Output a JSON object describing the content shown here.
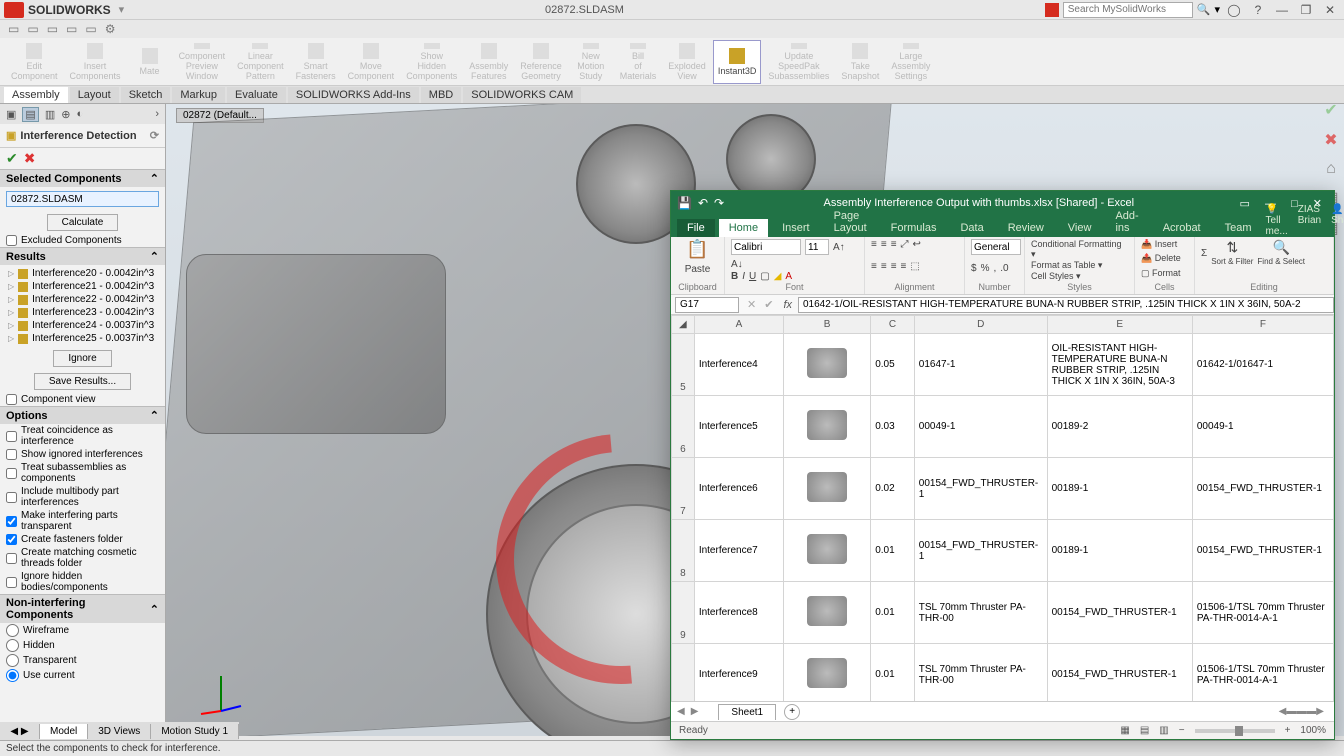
{
  "sw": {
    "brand": "SOLIDWORKS",
    "doc_title": "02872.SLDASM",
    "search_placeholder": "Search MySolidWorks",
    "ribbon": [
      {
        "label": "Edit Component"
      },
      {
        "label": "Insert Components"
      },
      {
        "label": "Mate"
      },
      {
        "label": "Component Preview Window"
      },
      {
        "label": "Linear Component Pattern"
      },
      {
        "label": "Smart Fasteners"
      },
      {
        "label": "Move Component"
      },
      {
        "label": "Show Hidden Components"
      },
      {
        "label": "Assembly Features"
      },
      {
        "label": "Reference Geometry"
      },
      {
        "label": "New Motion Study"
      },
      {
        "label": "Bill of Materials"
      },
      {
        "label": "Exploded View"
      },
      {
        "label": "Instant3D",
        "active": true
      },
      {
        "label": "Update SpeedPak Subassemblies"
      },
      {
        "label": "Take Snapshot"
      },
      {
        "label": "Large Assembly Settings"
      }
    ],
    "tabs": [
      "Assembly",
      "Layout",
      "Sketch",
      "Markup",
      "Evaluate",
      "SOLIDWORKS Add-Ins",
      "MBD",
      "SOLIDWORKS CAM"
    ],
    "active_tab": "Assembly",
    "viewport_tag": "02872  (Default...",
    "panel": {
      "title": "Interference Detection",
      "selected_head": "Selected Components",
      "selected_value": "02872.SLDASM",
      "calculate": "Calculate",
      "excluded_head": "Excluded Components",
      "results_head": "Results",
      "results": [
        "Interference20 - 0.0042in^3",
        "Interference21 - 0.0042in^3",
        "Interference22 - 0.0042in^3",
        "Interference23 - 0.0042in^3",
        "Interference24 - 0.0037in^3",
        "Interference25 - 0.0037in^3"
      ],
      "ignore": "Ignore",
      "save_results": "Save Results...",
      "component_view": "Component view",
      "options_head": "Options",
      "options": [
        {
          "label": "Treat coincidence as interference",
          "checked": false
        },
        {
          "label": "Show ignored interferences",
          "checked": false
        },
        {
          "label": "Treat subassemblies as components",
          "checked": false
        },
        {
          "label": "Include multibody part interferences",
          "checked": false
        },
        {
          "label": "Make interfering parts transparent",
          "checked": true
        },
        {
          "label": "Create fasteners folder",
          "checked": true
        },
        {
          "label": "Create matching cosmetic threads folder",
          "checked": false
        },
        {
          "label": "Ignore hidden bodies/components",
          "checked": false
        }
      ],
      "nonint_head": "Non-interfering Components",
      "nonint": [
        {
          "label": "Wireframe",
          "selected": false
        },
        {
          "label": "Hidden",
          "selected": false
        },
        {
          "label": "Transparent",
          "selected": false
        },
        {
          "label": "Use current",
          "selected": true
        }
      ]
    },
    "bottom_tabs": [
      "Model",
      "3D Views",
      "Motion Study 1"
    ],
    "status": "Select the components to check for interference."
  },
  "excel": {
    "title": "Assembly Interference Output with thumbs.xlsx  [Shared] - Excel",
    "tabs": [
      "File",
      "Home",
      "Insert",
      "Page Layout",
      "Formulas",
      "Data",
      "Review",
      "View",
      "Add-ins",
      "Acrobat",
      "Team"
    ],
    "active_tab": "Home",
    "tell_me": "Tell me...",
    "user": "ZIAS Brian",
    "share": "Share",
    "ribbon_groups": [
      "Clipboard",
      "Font",
      "Alignment",
      "Number",
      "Styles",
      "Cells",
      "Editing"
    ],
    "font_name": "Calibri",
    "font_size": "11",
    "number_format": "General",
    "cond_fmt": "Conditional Formatting",
    "fmt_table": "Format as Table",
    "cell_styles": "Cell Styles",
    "insert": "Insert",
    "delete": "Delete",
    "format": "Format",
    "sort_filter": "Sort & Filter",
    "find_select": "Find & Select",
    "paste": "Paste",
    "namebox": "G17",
    "formula": "01642-1/OIL-RESISTANT HIGH-TEMPERATURE BUNA-N RUBBER STRIP, .125IN THICK X 1IN X 36IN, 50A-2",
    "columns": [
      "A",
      "B",
      "C",
      "D",
      "E",
      "F"
    ],
    "rows": [
      {
        "n": 5,
        "a": "Interference4",
        "c": "0.05",
        "d": "01647-1",
        "e": "OIL-RESISTANT HIGH-TEMPERATURE BUNA-N RUBBER STRIP, .125IN THICK X 1IN X 36IN, 50A-3",
        "f": "01642-1/01647-1"
      },
      {
        "n": 6,
        "a": "Interference5",
        "c": "0.03",
        "d": "00049-1",
        "e": "00189-2",
        "f": "00049-1"
      },
      {
        "n": 7,
        "a": "Interference6",
        "c": "0.02",
        "d": "00154_FWD_THRUSTER-1",
        "e": "00189-1",
        "f": "00154_FWD_THRUSTER-1"
      },
      {
        "n": 8,
        "a": "Interference7",
        "c": "0.01",
        "d": "00154_FWD_THRUSTER-1",
        "e": "00189-1",
        "f": "00154_FWD_THRUSTER-1"
      },
      {
        "n": 9,
        "a": "Interference8",
        "c": "0.01",
        "d": "TSL 70mm Thruster PA-THR-00",
        "e": "00154_FWD_THRUSTER-1",
        "f": "01506-1/TSL 70mm Thruster PA-THR-0014-A-1"
      },
      {
        "n": "",
        "a": "Interference9",
        "c": "0.01",
        "d": "TSL 70mm Thruster PA-THR-00",
        "e": "00154_FWD_THRUSTER-1",
        "f": "01506-1/TSL 70mm Thruster PA-THR-0014-A-1"
      }
    ],
    "sheet": "Sheet1",
    "ready": "Ready",
    "zoom": "100%"
  }
}
